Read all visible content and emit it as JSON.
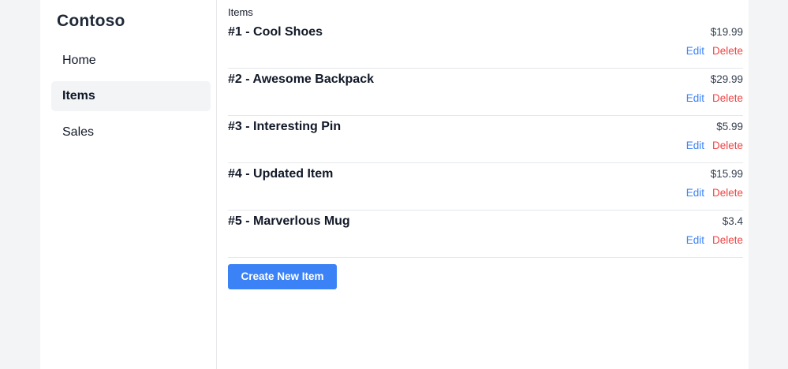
{
  "sidebar": {
    "brand": "Contoso",
    "items": [
      {
        "label": "Home",
        "active": false
      },
      {
        "label": "Items",
        "active": true
      },
      {
        "label": "Sales",
        "active": false
      }
    ]
  },
  "main": {
    "breadcrumb": "Items",
    "items": [
      {
        "title": "#1 - Cool Shoes",
        "price": "$19.99",
        "edit": "Edit",
        "delete": "Delete"
      },
      {
        "title": "#2 - Awesome Backpack",
        "price": "$29.99",
        "edit": "Edit",
        "delete": "Delete"
      },
      {
        "title": "#3 - Interesting Pin",
        "price": "$5.99",
        "edit": "Edit",
        "delete": "Delete"
      },
      {
        "title": "#4 - Updated Item",
        "price": "$15.99",
        "edit": "Edit",
        "delete": "Delete"
      },
      {
        "title": "#5 - Marverlous Mug",
        "price": "$3.4",
        "edit": "Edit",
        "delete": "Delete"
      }
    ],
    "create_button": "Create New Item"
  },
  "colors": {
    "accent": "#3b82f6",
    "danger": "#ef4444",
    "page_background": "#f3f4f6",
    "active_nav_background": "#f3f4f6"
  }
}
